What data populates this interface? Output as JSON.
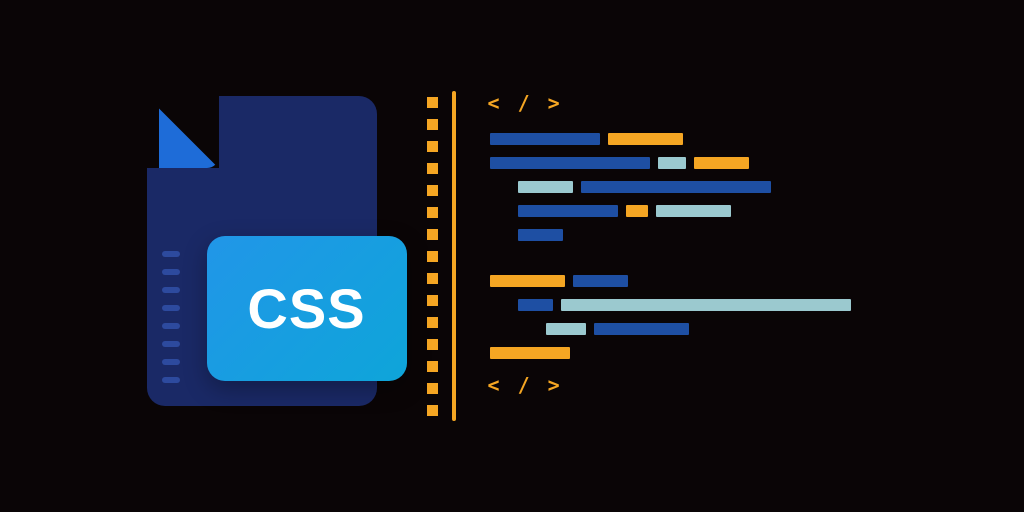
{
  "file": {
    "label": "CSS"
  },
  "code": {
    "open_tag": "< / >",
    "close_tag": "< / >"
  },
  "colors": {
    "background": "#0a0506",
    "file_dark": "#1a2966",
    "file_fold": "#1e6cd8",
    "badge_start": "#2196e8",
    "badge_end": "#0ea5d9",
    "accent_orange": "#f5a623",
    "code_blue": "#1e4fa3",
    "code_cyan": "#9bc9cf"
  }
}
